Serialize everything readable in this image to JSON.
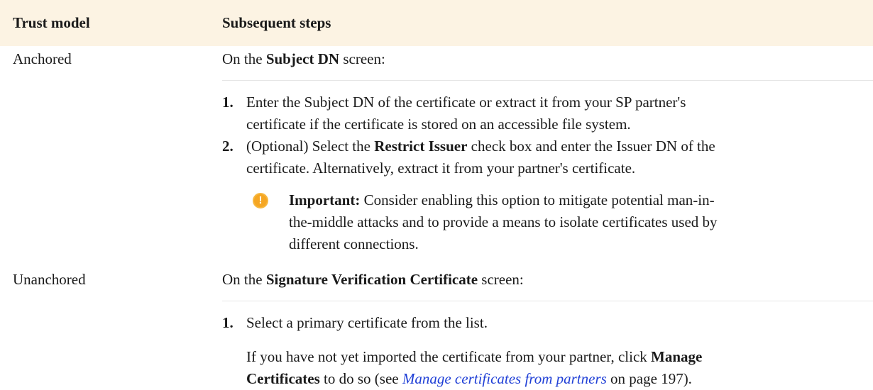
{
  "header": {
    "col1": "Trust model",
    "col2": "Subsequent steps"
  },
  "rows": [
    {
      "model": "Anchored",
      "intro_pre": "On the ",
      "intro_bold": "Subject DN",
      "intro_post": " screen:",
      "steps": [
        {
          "num": "1.",
          "line1": "Enter the Subject DN of the certificate or extract it from your SP partner's",
          "line2": "certificate if the certificate is stored on an accessible file system."
        },
        {
          "num": "2.",
          "line1_pre": "(Optional) Select the ",
          "line1_bold": "Restrict Issuer",
          "line1_post": " check box and enter the Issuer DN of the",
          "line2": "certificate. Alternatively, extract it from your partner's certificate."
        }
      ],
      "note": {
        "icon": "warning-icon",
        "label": "Important:",
        "line1": " Consider enabling this option to mitigate potential man-in-",
        "line2": "the-middle attacks and to provide a means to isolate certificates used by",
        "line3": "different connections."
      }
    },
    {
      "model": "Unanchored",
      "intro_pre": "On the ",
      "intro_bold": "Signature Verification Certificate",
      "intro_post": " screen:",
      "steps": [
        {
          "num": "1.",
          "line1": "Select a primary certificate from the list."
        }
      ],
      "para": {
        "line1_pre": "If you have not yet imported the certificate from your partner, click ",
        "line1_bold": "Manage",
        "line2_bold": "Certificates",
        "line2_mid": " to do so (see ",
        "link": "Manage certificates from partners",
        "line2_post": " on page 197)."
      }
    }
  ]
}
